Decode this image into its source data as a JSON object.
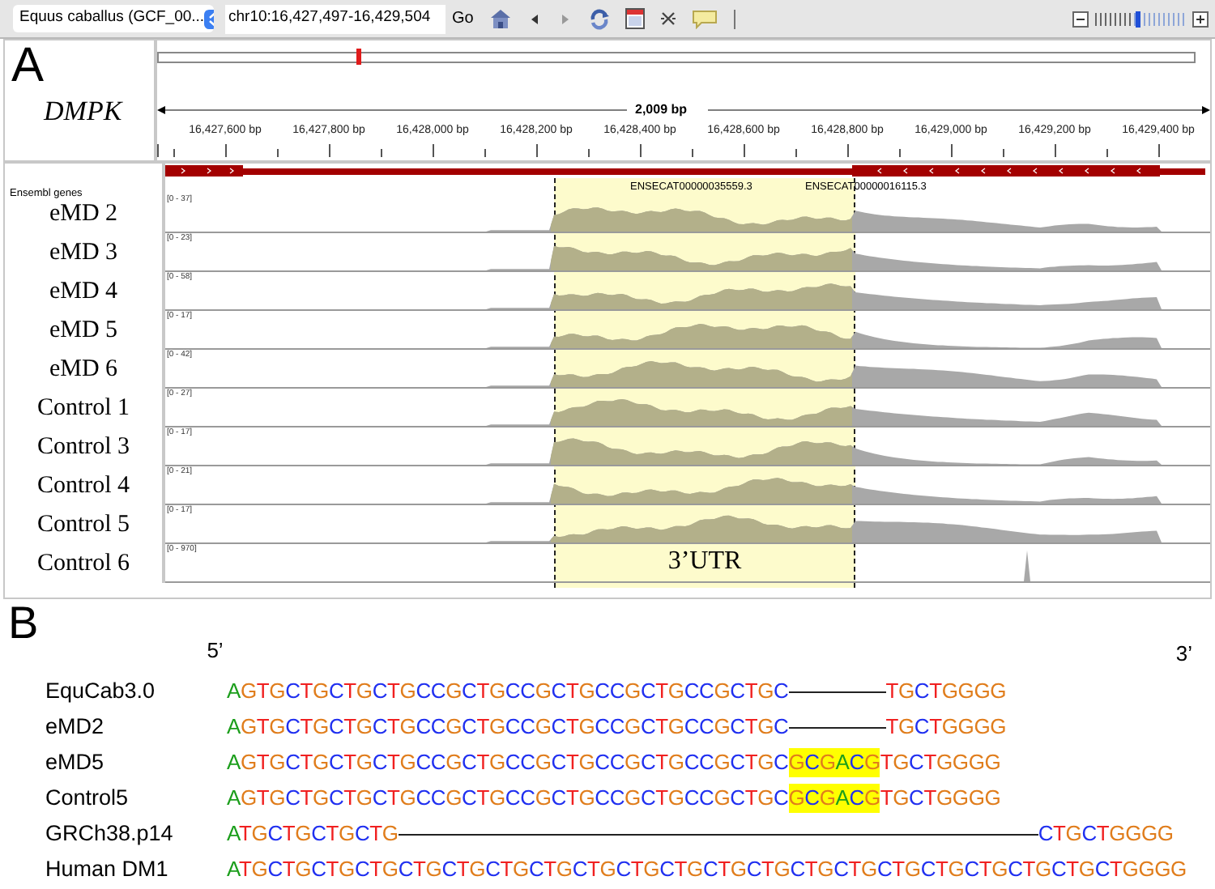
{
  "toolbar": {
    "genome": "Equus caballus (GCF_00...",
    "locus": "chr10:16,427,497-16,429,504",
    "go": "Go",
    "zoom": {
      "level": 0.48
    }
  },
  "panel_a": {
    "letter": "A",
    "gene": "DMPK",
    "span": "2,009 bp",
    "ruler": [
      "16,427,600 bp",
      "16,427,800 bp",
      "16,428,000 bp",
      "16,428,200 bp",
      "16,428,400 bp",
      "16,428,600 bp",
      "16,428,800 bp",
      "16,429,000 bp",
      "16,429,200 bp",
      "16,429,400 bp"
    ],
    "annotation_track": "Ensembl genes",
    "transcripts": [
      "ENSECAT00000035559.3",
      "ENSECAT00000016115.3"
    ],
    "region_label": "3’UTR",
    "tracks": [
      {
        "name": "eMD 2",
        "range": "[0 - 37]",
        "kind": "coverage"
      },
      {
        "name": "eMD 3",
        "range": "[0 - 23]",
        "kind": "coverage"
      },
      {
        "name": "eMD 4",
        "range": "[0 - 58]",
        "kind": "coverage"
      },
      {
        "name": "eMD 5",
        "range": "[0 - 17]",
        "kind": "coverage"
      },
      {
        "name": "eMD 6",
        "range": "[0 - 42]",
        "kind": "coverage"
      },
      {
        "name": "Control 1",
        "range": "[0 - 27]",
        "kind": "coverage"
      },
      {
        "name": "Control 3",
        "range": "[0 - 17]",
        "kind": "coverage"
      },
      {
        "name": "Control 4",
        "range": "[0 - 21]",
        "kind": "coverage"
      },
      {
        "name": "Control 5",
        "range": "[0 - 17]",
        "kind": "coverage"
      },
      {
        "name": "Control 6",
        "range": "[0 - 970]",
        "kind": "sparse"
      }
    ]
  },
  "panel_b": {
    "letter": "B",
    "five_prime": "5’",
    "three_prime": "3’",
    "rows": [
      {
        "name": "EquCab3.0",
        "segments": [
          {
            "kind": "bases",
            "text": "AGTGCTGCTGCTGCCGCTGCCGCTGCCGCTGCCGCTGC",
            "highlight": false
          },
          {
            "kind": "short_gap"
          },
          {
            "kind": "bases",
            "text": "TGCTGGGG",
            "highlight": false
          }
        ]
      },
      {
        "name": "eMD2",
        "segments": [
          {
            "kind": "bases",
            "text": "AGTGCTGCTGCTGCCGCTGCCGCTGCCGCTGCCGCTGC",
            "highlight": false
          },
          {
            "kind": "short_gap"
          },
          {
            "kind": "bases",
            "text": "TGCTGGGG",
            "highlight": false
          }
        ]
      },
      {
        "name": "eMD5",
        "segments": [
          {
            "kind": "bases",
            "text": "AGTGCTGCTGCTGCCGCTGCCGCTGCCGCTGCCGCTGC",
            "highlight": false
          },
          {
            "kind": "bases",
            "text": "GCGACG",
            "highlight": true
          },
          {
            "kind": "bases",
            "text": "TGCTGGGG",
            "highlight": false
          }
        ]
      },
      {
        "name": "Control5",
        "segments": [
          {
            "kind": "bases",
            "text": "AGTGCTGCTGCTGCCGCTGCCGCTGCCGCTGCCGCTGC",
            "highlight": false
          },
          {
            "kind": "bases",
            "text": "GCGACG",
            "highlight": true
          },
          {
            "kind": "bases",
            "text": "TGCTGGGG",
            "highlight": false
          }
        ]
      },
      {
        "name": "GRCh38.p14",
        "segments": [
          {
            "kind": "bases",
            "text": "ATGCTGCTGCTG",
            "highlight": false
          },
          {
            "kind": "long_gap"
          },
          {
            "kind": "bases",
            "text": "CTGCTGGGG",
            "highlight": false
          }
        ]
      },
      {
        "name": "Human DM1",
        "segments": [
          {
            "kind": "bases",
            "text": "ATGCTGCTGCTGCTGCTGCTGCTGCTGCTGCTGCTGCTGCTGCTGCTGCTGCTGCTGCTGCTGGGG",
            "highlight": false
          }
        ]
      }
    ]
  }
}
